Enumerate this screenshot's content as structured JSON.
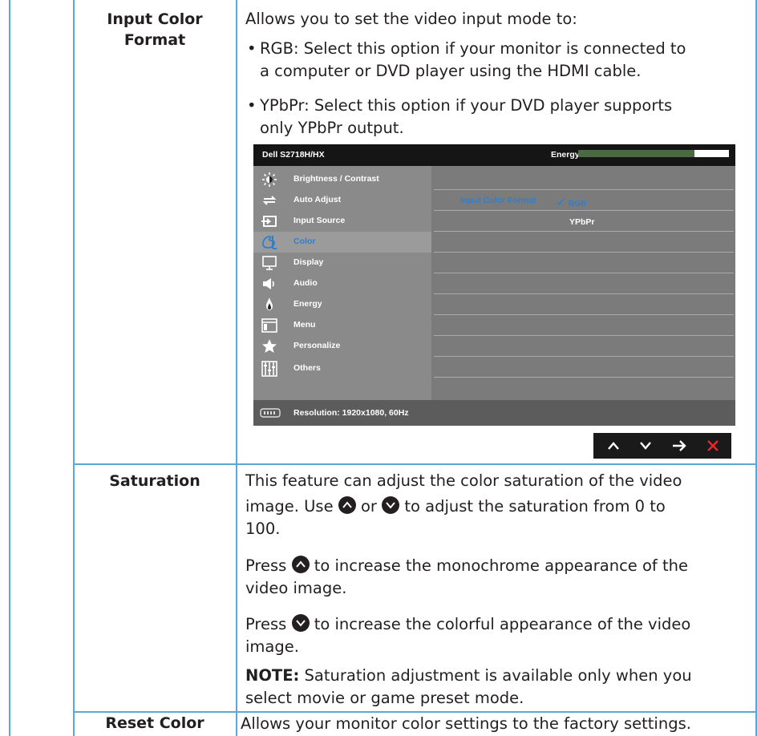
{
  "rows": {
    "input_color_format": {
      "label_line1": "Input Color",
      "label_line2": "Format",
      "intro": "Allows you to set the video input mode to:",
      "bullets": [
        {
          "line1": "RGB: Select this option if your monitor is connected to",
          "line2": "a computer or DVD player using the HDMI cable."
        },
        {
          "line1": "YPbPr: Select this option if your DVD player supports",
          "line2": "only YPbPr output."
        }
      ]
    },
    "saturation": {
      "label": "Saturation",
      "p1_line1": "This feature can adjust the color saturation of the video",
      "p1_l2_a": "image. Use",
      "p1_l2_b": "or",
      "p1_l2_c": "to adjust the saturation from 0 to",
      "p1_line3": "100.",
      "p2_a": "Press",
      "p2_b": "to increase the monochrome appearance of the",
      "p2_line2": "video image.",
      "p3_a": "Press",
      "p3_b": "to increase the colorful appearance of the video",
      "p3_line2": "image.",
      "note_bold": "NOTE:",
      "note_line1": "Saturation adjustment is available only when you",
      "note_line2": "select movie or game preset mode."
    },
    "reset_color": {
      "label": "Reset Color",
      "text": "Allows your monitor color settings to the factory settings."
    }
  },
  "osd": {
    "model": "Dell S2718H/HX",
    "energy_label": "Energy Use",
    "energy_level": 0.77,
    "menu": [
      {
        "label": "Brightness / Contrast",
        "icon": "brightness-icon"
      },
      {
        "label": "Auto Adjust",
        "icon": "auto-adjust-icon"
      },
      {
        "label": "Input Source",
        "icon": "input-source-icon"
      },
      {
        "label": "Color",
        "icon": "color-icon",
        "selected": true
      },
      {
        "label": "Display",
        "icon": "display-icon"
      },
      {
        "label": "Audio",
        "icon": "speaker-icon"
      },
      {
        "label": "Energy",
        "icon": "energy-icon"
      },
      {
        "label": "Menu",
        "icon": "menu-icon"
      },
      {
        "label": "Personalize",
        "icon": "star-icon"
      },
      {
        "label": "Others",
        "icon": "others-icon"
      }
    ],
    "option_label": "Input Color Format",
    "option_values": [
      "RGB",
      "YPbPr"
    ],
    "selected_value": "RGB",
    "resolution": "Resolution: 1920x1080, 60Hz",
    "nav_buttons": [
      "up-icon",
      "down-icon",
      "right-arrow-icon",
      "close-icon"
    ],
    "colors": {
      "accent": "#2e7fd0",
      "close": "#e8262d",
      "energy_fill": "#4a6b42"
    }
  }
}
